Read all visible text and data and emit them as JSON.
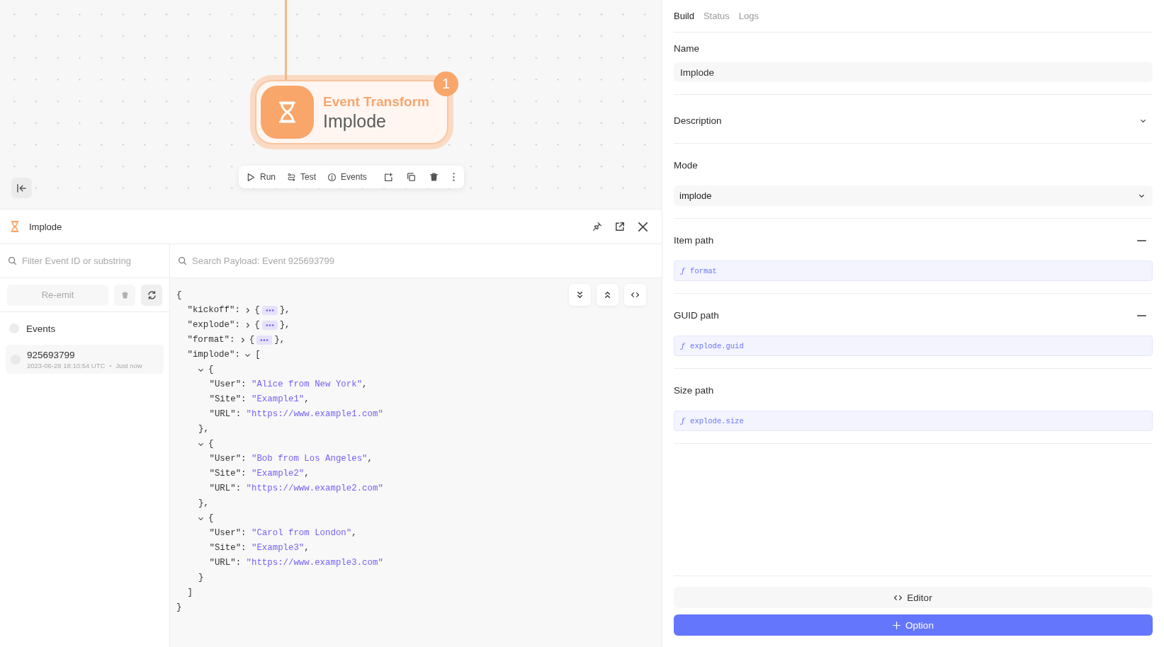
{
  "canvas": {
    "node": {
      "category": "Event Transform",
      "name": "Implode",
      "badge": "1",
      "selected": true
    },
    "toolbar": [
      {
        "kind": "run",
        "label": "Run"
      },
      {
        "kind": "test",
        "label": "Test"
      },
      {
        "kind": "events",
        "label": "Events"
      },
      {
        "kind": "open"
      },
      {
        "kind": "duplicate"
      },
      {
        "kind": "delete"
      },
      {
        "kind": "more"
      }
    ]
  },
  "panel": {
    "title": "Implode",
    "header_actions": [
      {
        "kind": "pin"
      },
      {
        "kind": "popout"
      },
      {
        "kind": "close"
      }
    ],
    "filter": {
      "placeholder": "Filter Event ID or substring"
    },
    "event_actions": [
      {
        "kind": "reemit",
        "label": "Re-emit",
        "disabled": true
      },
      {
        "kind": "delete",
        "disabled": true
      },
      {
        "kind": "refresh",
        "disabled": false
      }
    ],
    "events_header": {
      "label": "Events",
      "checked": false
    },
    "events": [
      {
        "id": "925693799",
        "time": "2023-06-28 18:10:54 UTC",
        "separator": "•",
        "age": "Just now",
        "checked": false
      }
    ],
    "search": {
      "placeholder": "Search Payload: Event 925693799"
    },
    "view_actions": [
      {
        "kind": "expand"
      },
      {
        "kind": "collapse"
      },
      {
        "kind": "code"
      }
    ],
    "payload": {
      "open": "{",
      "close": "}",
      "children": [
        {
          "kind": "node",
          "key": "\"kickoff\":",
          "expanded": false,
          "open": "{",
          "close": "},"
        },
        {
          "kind": "node",
          "key": "\"explode\":",
          "expanded": false,
          "open": "{",
          "close": "},"
        },
        {
          "kind": "node",
          "key": "\"format\":",
          "expanded": false,
          "open": "{",
          "close": "},"
        },
        {
          "kind": "node",
          "key": "\"implode\":",
          "expanded": true,
          "open": "[",
          "close": "]",
          "children": [
            {
              "kind": "node",
              "expanded": true,
              "open": "{",
              "close": "},",
              "children": [
                {
                  "kind": "value",
                  "key": "\"User\":",
                  "value": "\"Alice from New York\"",
                  "end": ","
                },
                {
                  "kind": "value",
                  "key": "\"Site\":",
                  "value": "\"Example1\"",
                  "end": ","
                },
                {
                  "kind": "value",
                  "key": "\"URL\":",
                  "value": "\"https://www.example1.com\""
                }
              ]
            },
            {
              "kind": "node",
              "expanded": true,
              "open": "{",
              "close": "},",
              "children": [
                {
                  "kind": "value",
                  "key": "\"User\":",
                  "value": "\"Bob from Los Angeles\"",
                  "end": ","
                },
                {
                  "kind": "value",
                  "key": "\"Site\":",
                  "value": "\"Example2\"",
                  "end": ","
                },
                {
                  "kind": "value",
                  "key": "\"URL\":",
                  "value": "\"https://www.example2.com\""
                }
              ]
            },
            {
              "kind": "node",
              "expanded": true,
              "open": "{",
              "close": "}",
              "children": [
                {
                  "kind": "value",
                  "key": "\"User\":",
                  "value": "\"Carol from London\"",
                  "end": ","
                },
                {
                  "kind": "value",
                  "key": "\"Site\":",
                  "value": "\"Example3\"",
                  "end": ","
                },
                {
                  "kind": "value",
                  "key": "\"URL\":",
                  "value": "\"https://www.example3.com\""
                }
              ]
            }
          ]
        }
      ]
    }
  },
  "inspector": {
    "tabs": [
      {
        "label": "Build",
        "selected": true
      },
      {
        "label": "Status",
        "selected": false
      },
      {
        "label": "Logs",
        "selected": false
      }
    ],
    "sections": [
      {
        "kind": "text",
        "label": "Name",
        "value": "Implode"
      },
      {
        "kind": "collapsible",
        "label": "Description",
        "expanded": false
      },
      {
        "kind": "select",
        "label": "Mode",
        "value": "implode"
      },
      {
        "kind": "expression",
        "label": "Item path",
        "prefix": "ƒ",
        "value": "format",
        "removable": true
      },
      {
        "kind": "expression",
        "label": "GUID path",
        "prefix": "ƒ",
        "value": "explode.guid",
        "removable": true
      },
      {
        "kind": "expression",
        "label": "Size path",
        "prefix": "ƒ",
        "value": "explode.size",
        "removable": false
      }
    ],
    "actions": [
      {
        "kind": "editor",
        "label": "Editor"
      },
      {
        "kind": "add",
        "label": "Option"
      }
    ]
  }
}
